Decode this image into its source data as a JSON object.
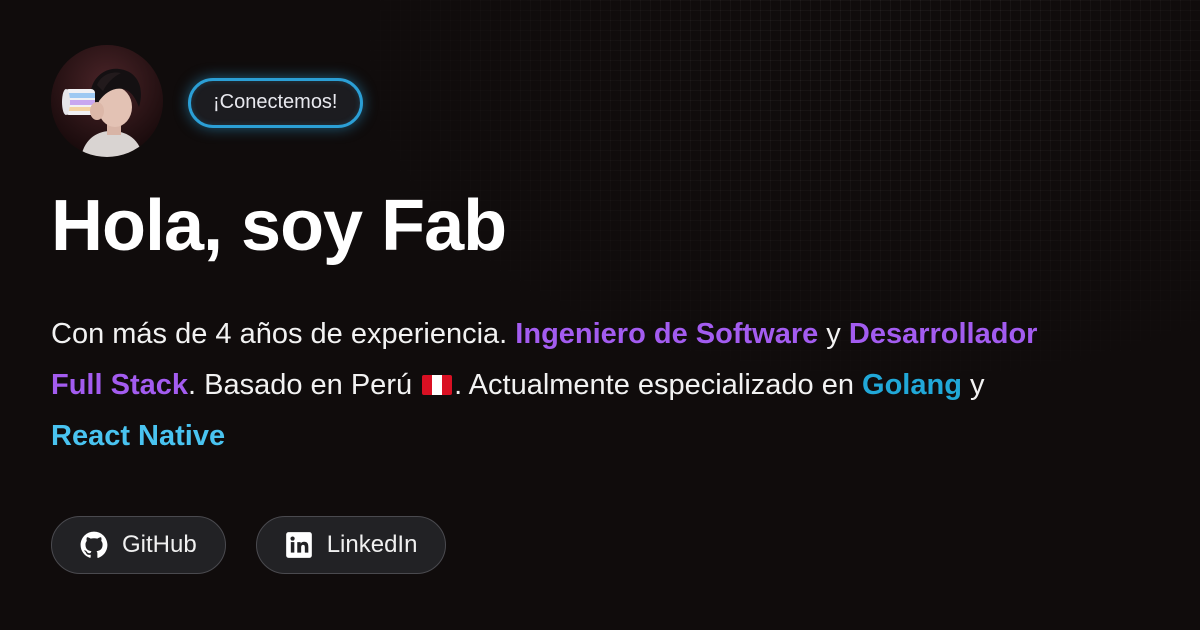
{
  "header": {
    "connect_label": "¡Conectemos!"
  },
  "hero": {
    "title": "Hola, soy Fab",
    "bio": {
      "part1": "Con más de 4 años de experiencia. ",
      "role1": "Ingeniero de Software",
      "conj1": " y ",
      "role2": "Desarrollador Full Stack",
      "part2": ". Basado en Perú ",
      "part3": ". Actualmente especializado en ",
      "tech1": "Golang",
      "conj2": " y ",
      "tech2": "React Native"
    }
  },
  "links": [
    {
      "label": "GitHub",
      "icon": "github-icon"
    },
    {
      "label": "LinkedIn",
      "icon": "linkedin-icon"
    }
  ],
  "colors": {
    "background": "#100c0c",
    "accent_purple": "#a35cf0",
    "accent_blue": "#21a8d8",
    "accent_light_blue": "#49c3f0",
    "badge_border": "#2b9fd6"
  }
}
